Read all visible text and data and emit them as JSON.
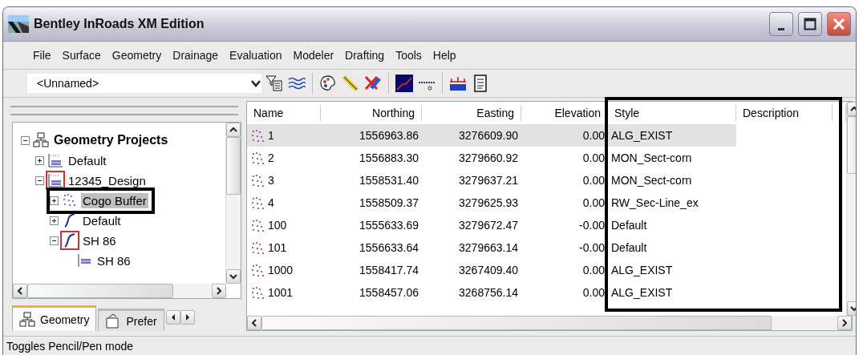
{
  "window": {
    "title": "Bentley InRoads XM Edition"
  },
  "menu": [
    "File",
    "Surface",
    "Geometry",
    "Drainage",
    "Evaluation",
    "Modeler",
    "Drafting",
    "Tools",
    "Help"
  ],
  "toolbar": {
    "combo": {
      "value": "<Unnamed>"
    }
  },
  "tree": [
    {
      "label": "Geometry Projects",
      "kind": "root",
      "expanded": true,
      "children": [
        {
          "label": "Default",
          "kind": "project",
          "expanded": false,
          "active": false
        },
        {
          "label": "12345_Design",
          "kind": "project",
          "expanded": true,
          "active": true,
          "children": [
            {
              "label": "Cogo Buffer",
              "kind": "cogo",
              "expanded": false,
              "selected": true,
              "callout": true
            },
            {
              "label": "Default",
              "kind": "horizontal",
              "expanded": false,
              "active": false
            },
            {
              "label": "SH 86",
              "kind": "horizontal",
              "expanded": true,
              "active": true,
              "children": [
                {
                  "label": "SH 86",
                  "kind": "vertical",
                  "active": false
                }
              ]
            }
          ]
        }
      ]
    }
  ],
  "panel_tabs": [
    {
      "label": "Geometry",
      "kind": "geometry",
      "selected": true
    },
    {
      "label": "Prefer",
      "kind": "preferences",
      "selected": false
    }
  ],
  "table": {
    "columns": [
      {
        "label": "Name",
        "outlined": false
      },
      {
        "label": "Northing",
        "outlined": false
      },
      {
        "label": "Easting",
        "outlined": false
      },
      {
        "label": "Elevation",
        "outlined": false
      },
      {
        "label": "Style",
        "outlined": true
      },
      {
        "label": "Description",
        "outlined": true
      }
    ],
    "rows": [
      {
        "selected": true,
        "cells": [
          "1",
          "1556963.86",
          "3276609.90",
          "0.00",
          "ALG_EXIST"
        ]
      },
      {
        "selected": false,
        "cells": [
          "2",
          "1556883.30",
          "3279660.92",
          "0.00",
          "MON_Sect-corn"
        ]
      },
      {
        "selected": false,
        "cells": [
          "3",
          "1558531.40",
          "3279637.21",
          "0.00",
          "MON_Sect-corn"
        ]
      },
      {
        "selected": false,
        "cells": [
          "4",
          "1558509.37",
          "3279625.93",
          "0.00",
          "RW_Sec-Line_ex"
        ]
      },
      {
        "selected": false,
        "cells": [
          "100",
          "1555633.69",
          "3279672.47",
          "-0.00",
          "Default"
        ]
      },
      {
        "selected": false,
        "cells": [
          "101",
          "1556633.64",
          "3279663.14",
          "-0.00",
          "Default"
        ]
      },
      {
        "selected": false,
        "cells": [
          "1000",
          "1558417.74",
          "3267409.40",
          "0.00",
          "ALG_EXIST"
        ]
      },
      {
        "selected": false,
        "cells": [
          "1001",
          "1558457.06",
          "3268756.14",
          "0.00",
          "ALG_EXIST"
        ]
      }
    ]
  },
  "status_bar": "Toggles Pencil/Pen mode"
}
